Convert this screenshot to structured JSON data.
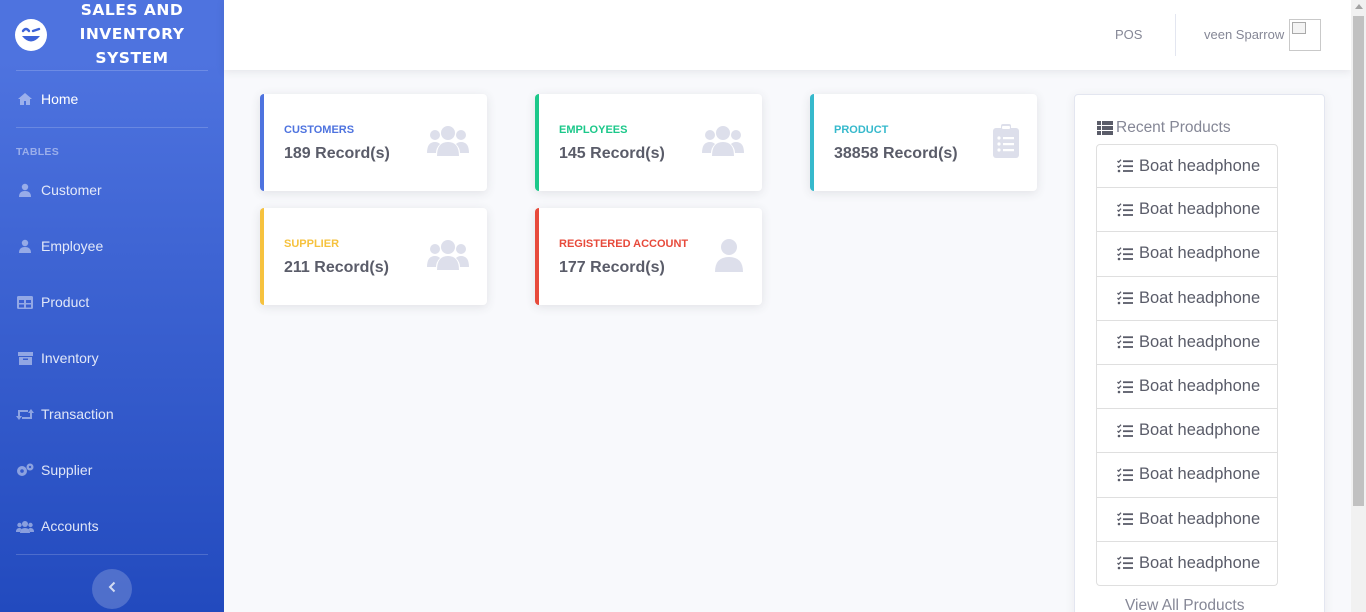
{
  "sidebar": {
    "brand": "SALES AND INVENTORY SYSTEM",
    "home": "Home",
    "heading": "TABLES",
    "items": [
      {
        "label": "Customer",
        "icon": "user-icon"
      },
      {
        "label": "Employee",
        "icon": "user-icon"
      },
      {
        "label": "Product",
        "icon": "table-icon"
      },
      {
        "label": "Inventory",
        "icon": "archive-icon"
      },
      {
        "label": "Transaction",
        "icon": "retweet-icon"
      },
      {
        "label": "Supplier",
        "icon": "cogs-icon"
      },
      {
        "label": "Accounts",
        "icon": "users-icon"
      }
    ]
  },
  "topbar": {
    "pos": "POS",
    "user": "veen Sparrow"
  },
  "cards": [
    {
      "label": "CUSTOMERS",
      "value": "189 Record(s)",
      "color": "#4e73df",
      "icon": "users-icon"
    },
    {
      "label": "EMPLOYEES",
      "value": "145 Record(s)",
      "color": "#1cc88a",
      "icon": "users-icon"
    },
    {
      "label": "PRODUCT",
      "value": "38858 Record(s)",
      "color": "#36b9cc",
      "icon": "clipboard-list-icon"
    },
    {
      "label": "SUPPLIER",
      "value": "211 Record(s)",
      "color": "#f6c23e",
      "icon": "users-icon"
    },
    {
      "label": "REGISTERED ACCOUNT",
      "value": "177 Record(s)",
      "color": "#e74a3b",
      "icon": "user-icon"
    }
  ],
  "recent": {
    "title": "Recent Products",
    "items": [
      "Boat headphone",
      "Boat headphone",
      "Boat headphone",
      "Boat headphone",
      "Boat headphone",
      "Boat headphone",
      "Boat headphone",
      "Boat headphone",
      "Boat headphone",
      "Boat headphone"
    ],
    "view_all": "View All Products"
  }
}
